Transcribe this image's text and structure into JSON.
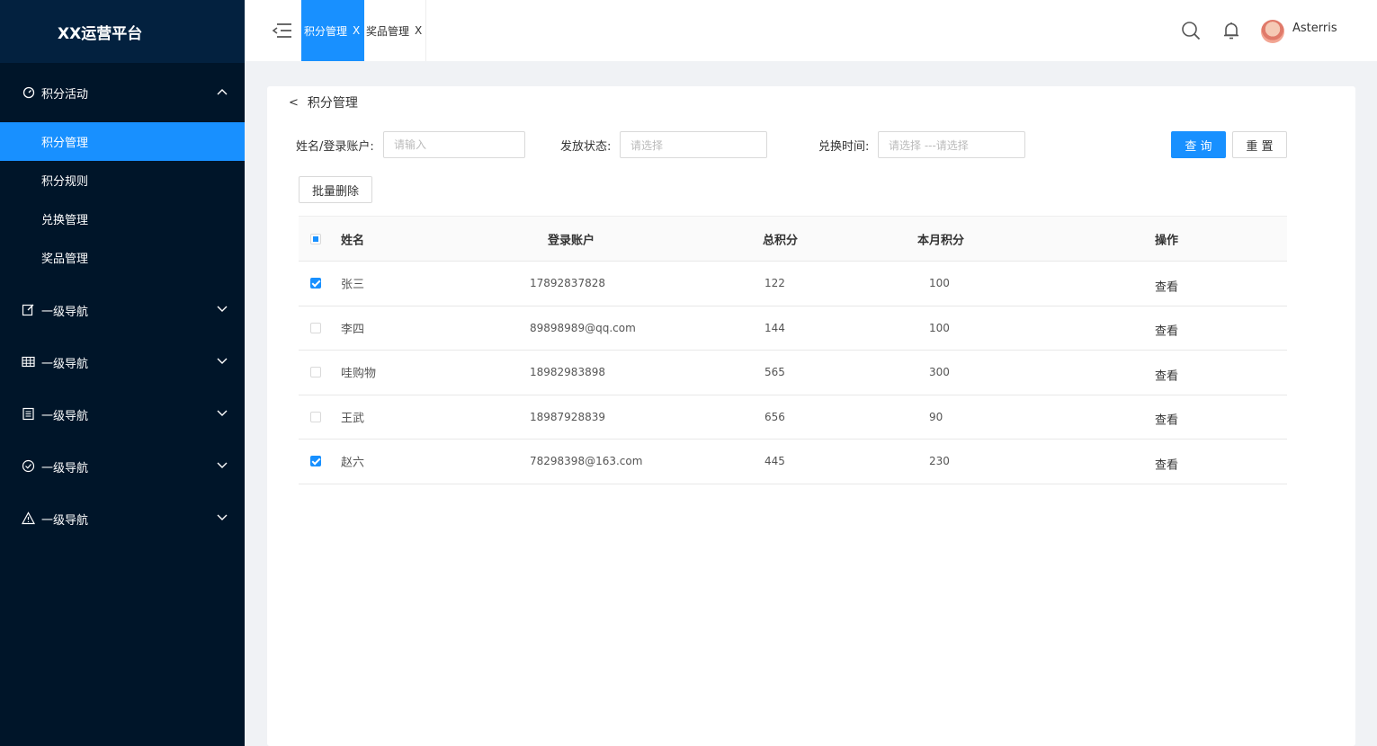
{
  "app": {
    "title": "XX运营平台"
  },
  "sidebar": {
    "group": {
      "label": "积分活动"
    },
    "sub_items": [
      {
        "label": "积分管理",
        "active": true
      },
      {
        "label": "积分规则",
        "active": false
      },
      {
        "label": "兑换管理",
        "active": false
      },
      {
        "label": "奖品管理",
        "active": false
      }
    ],
    "nav_items": [
      {
        "label": "一级导航",
        "icon": "edit-icon"
      },
      {
        "label": "一级导航",
        "icon": "table-icon"
      },
      {
        "label": "一级导航",
        "icon": "list-icon"
      },
      {
        "label": "一级导航",
        "icon": "check-circle-icon"
      },
      {
        "label": "一级导航",
        "icon": "warning-icon"
      }
    ]
  },
  "topbar": {
    "tabs": [
      {
        "label": "积分管理",
        "close": "X",
        "active": true
      },
      {
        "label": "奖品管理",
        "close": "X",
        "active": false
      }
    ],
    "user": {
      "name": "Asterris"
    }
  },
  "page": {
    "back_symbol": "<",
    "title": "积分管理"
  },
  "filters": {
    "name_label": "姓名/登录账户:",
    "name_placeholder": "请输入",
    "status_label": "发放状态:",
    "status_placeholder": "请选择",
    "time_label": "兑换时间:",
    "time_placeholder": "请选择 ---请选择",
    "query_button": "查 询",
    "reset_button": "重 置"
  },
  "actions": {
    "batch_delete": "批量删除"
  },
  "table": {
    "headers": {
      "name": "姓名",
      "account": "登录账户",
      "total": "总积分",
      "monthly": "本月积分",
      "operation": "操作"
    },
    "rows": [
      {
        "checked": true,
        "name": "张三",
        "account": "17892837828",
        "total": "122",
        "monthly": "100",
        "action": "查看"
      },
      {
        "checked": false,
        "name": "李四",
        "account": "89898989@qq.com",
        "total": "144",
        "monthly": "100",
        "action": "查看"
      },
      {
        "checked": false,
        "name": "哇购物",
        "account": "18982983898",
        "total": "565",
        "monthly": "300",
        "action": "查看"
      },
      {
        "checked": false,
        "name": "王武",
        "account": "18987928839",
        "total": "656",
        "monthly": "90",
        "action": "查看"
      },
      {
        "checked": true,
        "name": "赵六",
        "account": "78298398@163.com",
        "total": "445",
        "monthly": "230",
        "action": "查看"
      }
    ]
  },
  "colors": {
    "sidebar_bg": "#001529",
    "logo_bg": "#03213f",
    "primary": "#1890ff"
  }
}
